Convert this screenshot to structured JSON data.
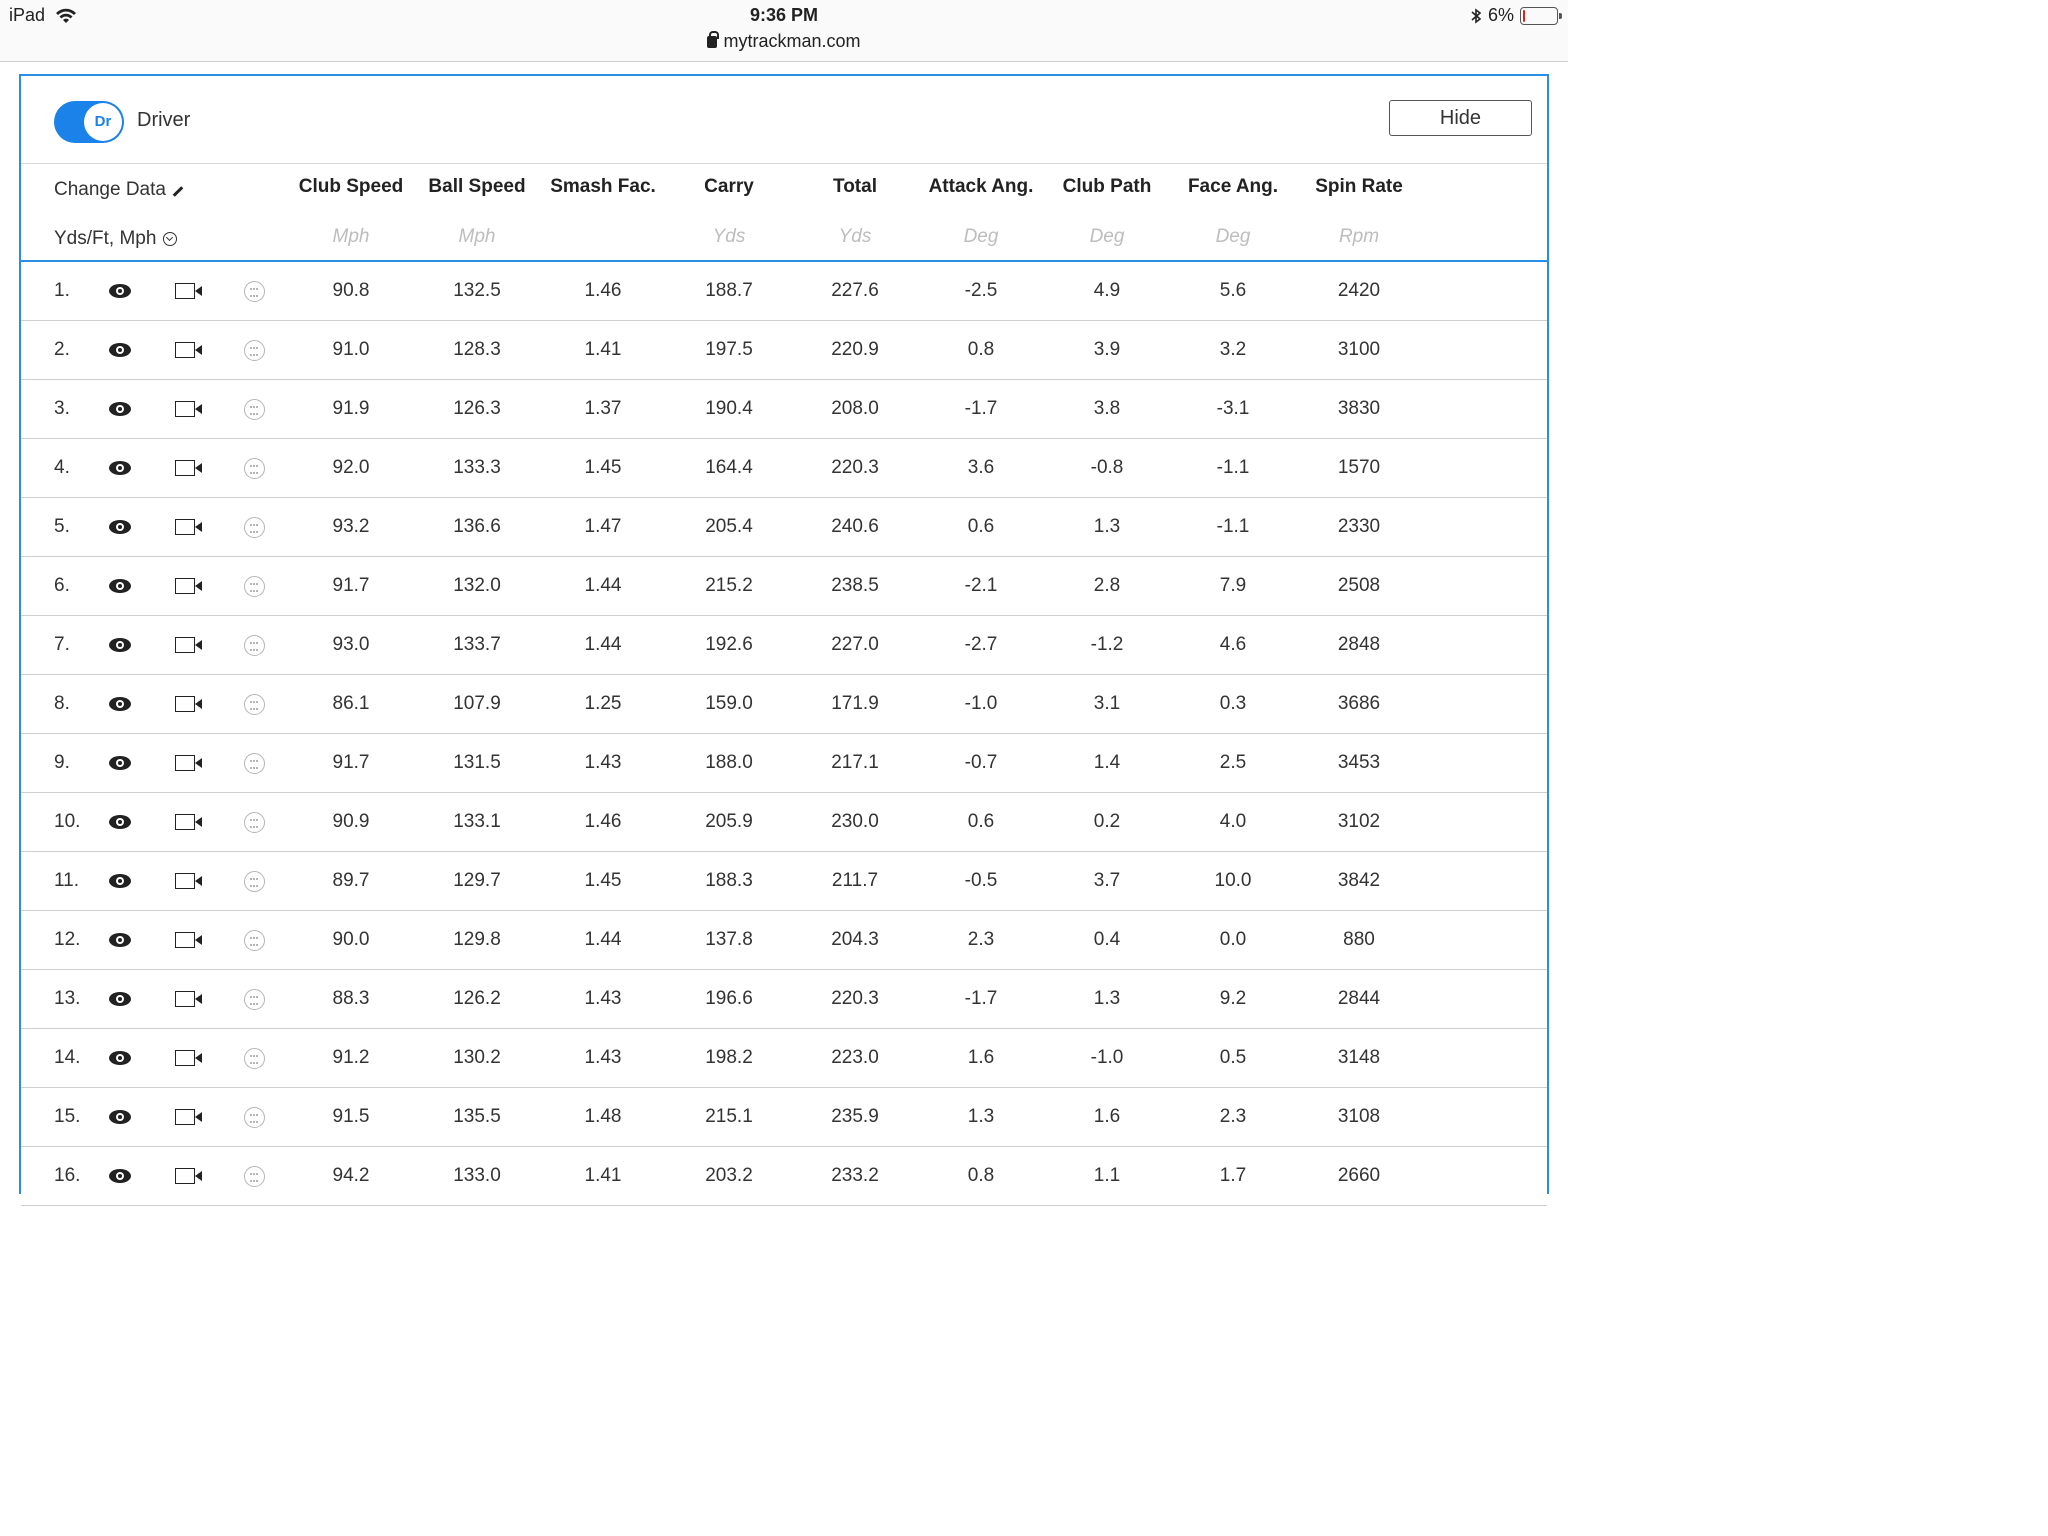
{
  "status_bar": {
    "device": "iPad",
    "time": "9:36 PM",
    "url": "mytrackman.com",
    "battery": "6%",
    "battery_level": 0.06
  },
  "club": {
    "badge": "Dr",
    "name": "Driver",
    "hide_label": "Hide"
  },
  "table": {
    "change_data_label": "Change Data",
    "units_label": "Yds/Ft, Mph",
    "columns": [
      {
        "label": "Club Speed",
        "unit": "Mph"
      },
      {
        "label": "Ball Speed",
        "unit": "Mph"
      },
      {
        "label": "Smash Fac.",
        "unit": ""
      },
      {
        "label": "Carry",
        "unit": "Yds"
      },
      {
        "label": "Total",
        "unit": "Yds"
      },
      {
        "label": "Attack Ang.",
        "unit": "Deg"
      },
      {
        "label": "Club Path",
        "unit": "Deg"
      },
      {
        "label": "Face Ang.",
        "unit": "Deg"
      },
      {
        "label": "Spin Rate",
        "unit": "Rpm"
      }
    ],
    "rows": [
      {
        "num": "1.",
        "values": [
          "90.8",
          "132.5",
          "1.46",
          "188.7",
          "227.6",
          "-2.5",
          "4.9",
          "5.6",
          "2420"
        ]
      },
      {
        "num": "2.",
        "values": [
          "91.0",
          "128.3",
          "1.41",
          "197.5",
          "220.9",
          "0.8",
          "3.9",
          "3.2",
          "3100"
        ]
      },
      {
        "num": "3.",
        "values": [
          "91.9",
          "126.3",
          "1.37",
          "190.4",
          "208.0",
          "-1.7",
          "3.8",
          "-3.1",
          "3830"
        ]
      },
      {
        "num": "4.",
        "values": [
          "92.0",
          "133.3",
          "1.45",
          "164.4",
          "220.3",
          "3.6",
          "-0.8",
          "-1.1",
          "1570"
        ]
      },
      {
        "num": "5.",
        "values": [
          "93.2",
          "136.6",
          "1.47",
          "205.4",
          "240.6",
          "0.6",
          "1.3",
          "-1.1",
          "2330"
        ]
      },
      {
        "num": "6.",
        "values": [
          "91.7",
          "132.0",
          "1.44",
          "215.2",
          "238.5",
          "-2.1",
          "2.8",
          "7.9",
          "2508"
        ]
      },
      {
        "num": "7.",
        "values": [
          "93.0",
          "133.7",
          "1.44",
          "192.6",
          "227.0",
          "-2.7",
          "-1.2",
          "4.6",
          "2848"
        ]
      },
      {
        "num": "8.",
        "values": [
          "86.1",
          "107.9",
          "1.25",
          "159.0",
          "171.9",
          "-1.0",
          "3.1",
          "0.3",
          "3686"
        ]
      },
      {
        "num": "9.",
        "values": [
          "91.7",
          "131.5",
          "1.43",
          "188.0",
          "217.1",
          "-0.7",
          "1.4",
          "2.5",
          "3453"
        ]
      },
      {
        "num": "10.",
        "values": [
          "90.9",
          "133.1",
          "1.46",
          "205.9",
          "230.0",
          "0.6",
          "0.2",
          "4.0",
          "3102"
        ]
      },
      {
        "num": "11.",
        "values": [
          "89.7",
          "129.7",
          "1.45",
          "188.3",
          "211.7",
          "-0.5",
          "3.7",
          "10.0",
          "3842"
        ]
      },
      {
        "num": "12.",
        "values": [
          "90.0",
          "129.8",
          "1.44",
          "137.8",
          "204.3",
          "2.3",
          "0.4",
          "0.0",
          "880"
        ]
      },
      {
        "num": "13.",
        "values": [
          "88.3",
          "126.2",
          "1.43",
          "196.6",
          "220.3",
          "-1.7",
          "1.3",
          "9.2",
          "2844"
        ]
      },
      {
        "num": "14.",
        "values": [
          "91.2",
          "130.2",
          "1.43",
          "198.2",
          "223.0",
          "1.6",
          "-1.0",
          "0.5",
          "3148"
        ]
      },
      {
        "num": "15.",
        "values": [
          "91.5",
          "135.5",
          "1.48",
          "215.1",
          "235.9",
          "1.3",
          "1.6",
          "2.3",
          "3108"
        ]
      },
      {
        "num": "16.",
        "values": [
          "94.2",
          "133.0",
          "1.41",
          "203.2",
          "233.2",
          "0.8",
          "1.1",
          "1.7",
          "2660"
        ]
      }
    ]
  },
  "colors": {
    "accent": "#2a8ee6",
    "toggle": "#1a82e8",
    "battery_low": "#e02020"
  }
}
